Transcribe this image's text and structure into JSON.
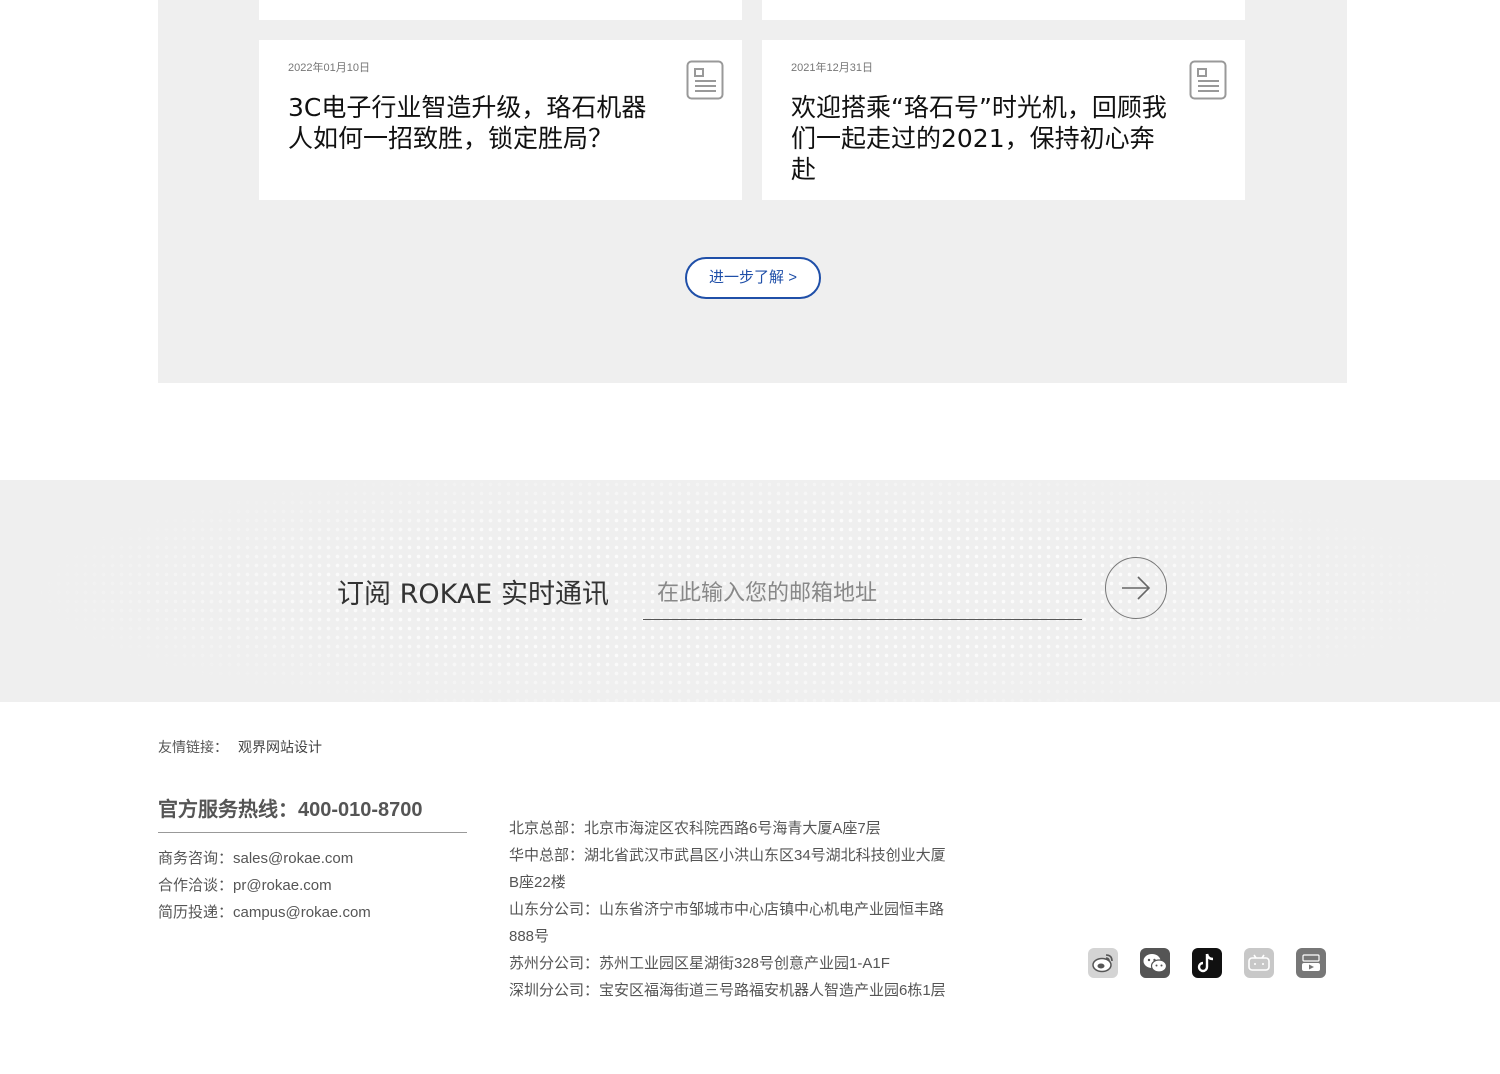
{
  "news": {
    "cards": [
      {
        "date": "2022年01月10日",
        "title": "3C电子行业智造升级，珞石机器人如何一招致胜，锁定胜局？"
      },
      {
        "date": "2021年12月31日",
        "title": "欢迎搭乘“珞石号”时光机，回顾我们一起走过的2021，保持初心奔赴"
      }
    ],
    "more_label": "进一步了解 >"
  },
  "subscribe": {
    "title": "订阅 ROKAE 实时通讯",
    "placeholder": "在此输入您的邮箱地址"
  },
  "footer": {
    "friend_links_label": "友情链接：",
    "friend_link": "观界网站设计",
    "hotline": "官方服务热线：400-010-8700",
    "contacts": [
      "商务咨询：sales@rokae.com",
      "合作洽谈：pr@rokae.com",
      "简历投递：campus@rokae.com"
    ],
    "addresses": [
      "北京总部：北京市海淀区农科院西路6号海青大厦A座7层",
      "华中总部：湖北省武汉市武昌区小洪山东区34号湖北科技创业大厦B座22楼",
      "山东分公司：山东省济宁市邹城市中心店镇中心机电产业园恒丰路888号",
      "苏州分公司：苏州工业园区星湖街328号创意产业园1-A1F",
      "深圳分公司：宝安区福海街道三号路福安机器人智造产业园6栋1层"
    ],
    "socials": [
      "weibo-icon",
      "wechat-icon",
      "tiktok-icon",
      "bilibili-icon",
      "youtube-icon"
    ]
  }
}
